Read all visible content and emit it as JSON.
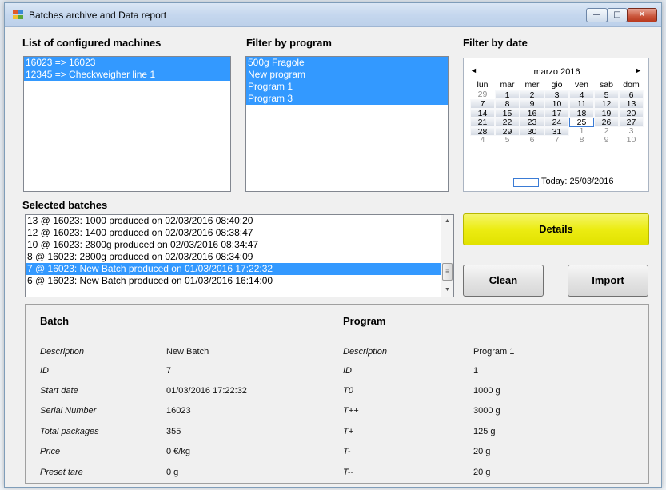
{
  "window": {
    "title": "Batches archive and Data report"
  },
  "title_buttons": {
    "minimize": "—",
    "maximize": "□",
    "close": "✕"
  },
  "machines": {
    "label": "List of configured machines",
    "items": [
      {
        "text": "16023 => 16023",
        "selected": true
      },
      {
        "text": "12345 => Checkweigher line 1",
        "selected": true
      }
    ]
  },
  "programs": {
    "label": "Filter by program",
    "items": [
      {
        "text": "500g Fragole",
        "selected": true
      },
      {
        "text": "New program",
        "selected": true
      },
      {
        "text": "Program 1",
        "selected": true
      },
      {
        "text": "Program 3",
        "selected": true
      }
    ]
  },
  "date_filter": {
    "label": "Filter by date",
    "month": "marzo 2016",
    "prev": "◄",
    "next": "►",
    "weekdays": [
      "lun",
      "mar",
      "mer",
      "gio",
      "ven",
      "sab",
      "dom"
    ],
    "weeks": [
      [
        {
          "d": "29",
          "t": "other"
        },
        {
          "d": "1",
          "t": "cur"
        },
        {
          "d": "2",
          "t": "cur"
        },
        {
          "d": "3",
          "t": "cur"
        },
        {
          "d": "4",
          "t": "cur"
        },
        {
          "d": "5",
          "t": "cur"
        },
        {
          "d": "6",
          "t": "cur"
        }
      ],
      [
        {
          "d": "7",
          "t": "cur"
        },
        {
          "d": "8",
          "t": "cur"
        },
        {
          "d": "9",
          "t": "cur"
        },
        {
          "d": "10",
          "t": "cur"
        },
        {
          "d": "11",
          "t": "cur"
        },
        {
          "d": "12",
          "t": "cur"
        },
        {
          "d": "13",
          "t": "cur"
        }
      ],
      [
        {
          "d": "14",
          "t": "cur"
        },
        {
          "d": "15",
          "t": "cur"
        },
        {
          "d": "16",
          "t": "cur"
        },
        {
          "d": "17",
          "t": "cur"
        },
        {
          "d": "18",
          "t": "cur"
        },
        {
          "d": "19",
          "t": "cur"
        },
        {
          "d": "20",
          "t": "cur"
        }
      ],
      [
        {
          "d": "21",
          "t": "cur"
        },
        {
          "d": "22",
          "t": "cur"
        },
        {
          "d": "23",
          "t": "cur"
        },
        {
          "d": "24",
          "t": "cur"
        },
        {
          "d": "25",
          "t": "today"
        },
        {
          "d": "26",
          "t": "cur"
        },
        {
          "d": "27",
          "t": "cur"
        }
      ],
      [
        {
          "d": "28",
          "t": "cur"
        },
        {
          "d": "29",
          "t": "cur"
        },
        {
          "d": "30",
          "t": "cur"
        },
        {
          "d": "31",
          "t": "cur"
        },
        {
          "d": "1",
          "t": "other"
        },
        {
          "d": "2",
          "t": "other"
        },
        {
          "d": "3",
          "t": "other"
        }
      ],
      [
        {
          "d": "4",
          "t": "other"
        },
        {
          "d": "5",
          "t": "other"
        },
        {
          "d": "6",
          "t": "other"
        },
        {
          "d": "7",
          "t": "other"
        },
        {
          "d": "8",
          "t": "other"
        },
        {
          "d": "9",
          "t": "other"
        },
        {
          "d": "10",
          "t": "other"
        }
      ]
    ],
    "today_text": "Today: 25/03/2016"
  },
  "batches": {
    "label": "Selected batches",
    "items": [
      {
        "text": "13 @ 16023: 1000 produced on 02/03/2016 08:40:20",
        "selected": false
      },
      {
        "text": "12 @ 16023: 1400 produced on 02/03/2016 08:38:47",
        "selected": false
      },
      {
        "text": "10 @ 16023: 2800g produced on 02/03/2016 08:34:47",
        "selected": false
      },
      {
        "text": "8 @ 16023: 2800g produced on 02/03/2016 08:34:09",
        "selected": false
      },
      {
        "text": "7 @ 16023: New Batch produced on 01/03/2016 17:22:32",
        "selected": true
      },
      {
        "text": "6 @ 16023: New Batch produced on 01/03/2016 16:14:00",
        "selected": false
      }
    ],
    "scroll_up": "▲",
    "scroll_down": "▼",
    "scroll_grip": "≡"
  },
  "actions": {
    "details": "Details",
    "clean": "Clean",
    "import": "Import"
  },
  "batch_details": {
    "heading": "Batch",
    "rows": [
      {
        "label": "Description",
        "value": "New Batch"
      },
      {
        "label": "ID",
        "value": "7"
      },
      {
        "label": "Start date",
        "value": "01/03/2016 17:22:32"
      },
      {
        "label": "Serial Number",
        "value": "16023"
      },
      {
        "label": "Total packages",
        "value": "355"
      },
      {
        "label": "Price",
        "value": "0 €/kg"
      },
      {
        "label": "Preset tare",
        "value": "0 g"
      }
    ]
  },
  "program_details": {
    "heading": "Program",
    "rows": [
      {
        "label": "Description",
        "value": "Program 1"
      },
      {
        "label": "ID",
        "value": "1"
      },
      {
        "label": "T0",
        "value": "1000 g"
      },
      {
        "label": "T++",
        "value": "3000 g"
      },
      {
        "label": "T+",
        "value": "125 g"
      },
      {
        "label": "T-",
        "value": "20 g"
      },
      {
        "label": "T--",
        "value": "20 g"
      }
    ]
  },
  "colors": {
    "selection": "#3399ff",
    "details_button": "#ecec12",
    "today_border": "#3a7bd5"
  }
}
